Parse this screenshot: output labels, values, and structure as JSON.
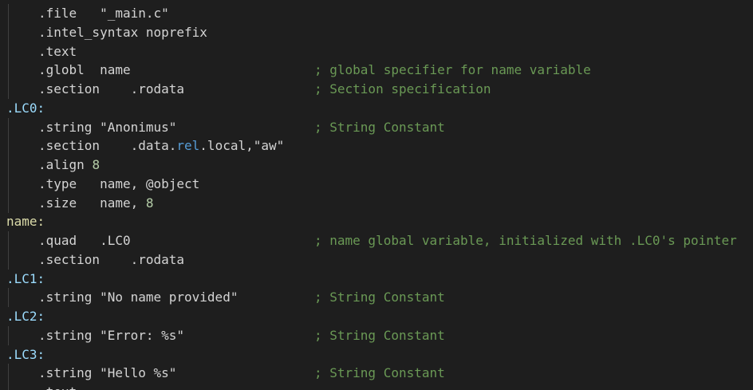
{
  "lines": [
    {
      "code": ".file   \"_main.c\"",
      "comment": ""
    },
    {
      "code": ".intel_syntax noprefix",
      "comment": ""
    },
    {
      "code": ".text",
      "comment": ""
    },
    {
      "code": ".globl  name",
      "comment": "; global specifier for name variable"
    },
    {
      "code": ".section    .rodata",
      "comment": "; Section specification"
    },
    {
      "label": ".LC0:"
    },
    {
      "code": ".string \"Anonimus\"",
      "comment": "; String Constant"
    },
    {
      "code_parts": [
        ".section    .data.",
        "rel",
        ".local,\"aw\""
      ],
      "comment": ""
    },
    {
      "code_parts": [
        ".align ",
        "8"
      ],
      "comment": ""
    },
    {
      "code": ".type   name, @object",
      "comment": ""
    },
    {
      "code_parts": [
        ".size   name, ",
        "8"
      ],
      "comment": ""
    },
    {
      "label": "name:"
    },
    {
      "code": ".quad   .LC0",
      "comment": "; name global variable, initialized with .LC0's pointer"
    },
    {
      "code": ".section    .rodata",
      "comment": ""
    },
    {
      "label": ".LC1:"
    },
    {
      "code": ".string \"No name provided\"",
      "comment": "; String Constant"
    },
    {
      "label": ".LC2:"
    },
    {
      "code": ".string \"Error: %s\"",
      "comment": "; String Constant"
    },
    {
      "label": ".LC3:"
    },
    {
      "code": ".string \"Hello %s\"",
      "comment": "; String Constant"
    },
    {
      "code": ".text",
      "comment": ""
    }
  ],
  "colors": {
    "background": "#1e1e1e",
    "text": "#d4d4d4",
    "comment": "#6a9955",
    "number": "#b5cea8",
    "keyword": "#569cd6",
    "label": "#9cdcfe"
  }
}
